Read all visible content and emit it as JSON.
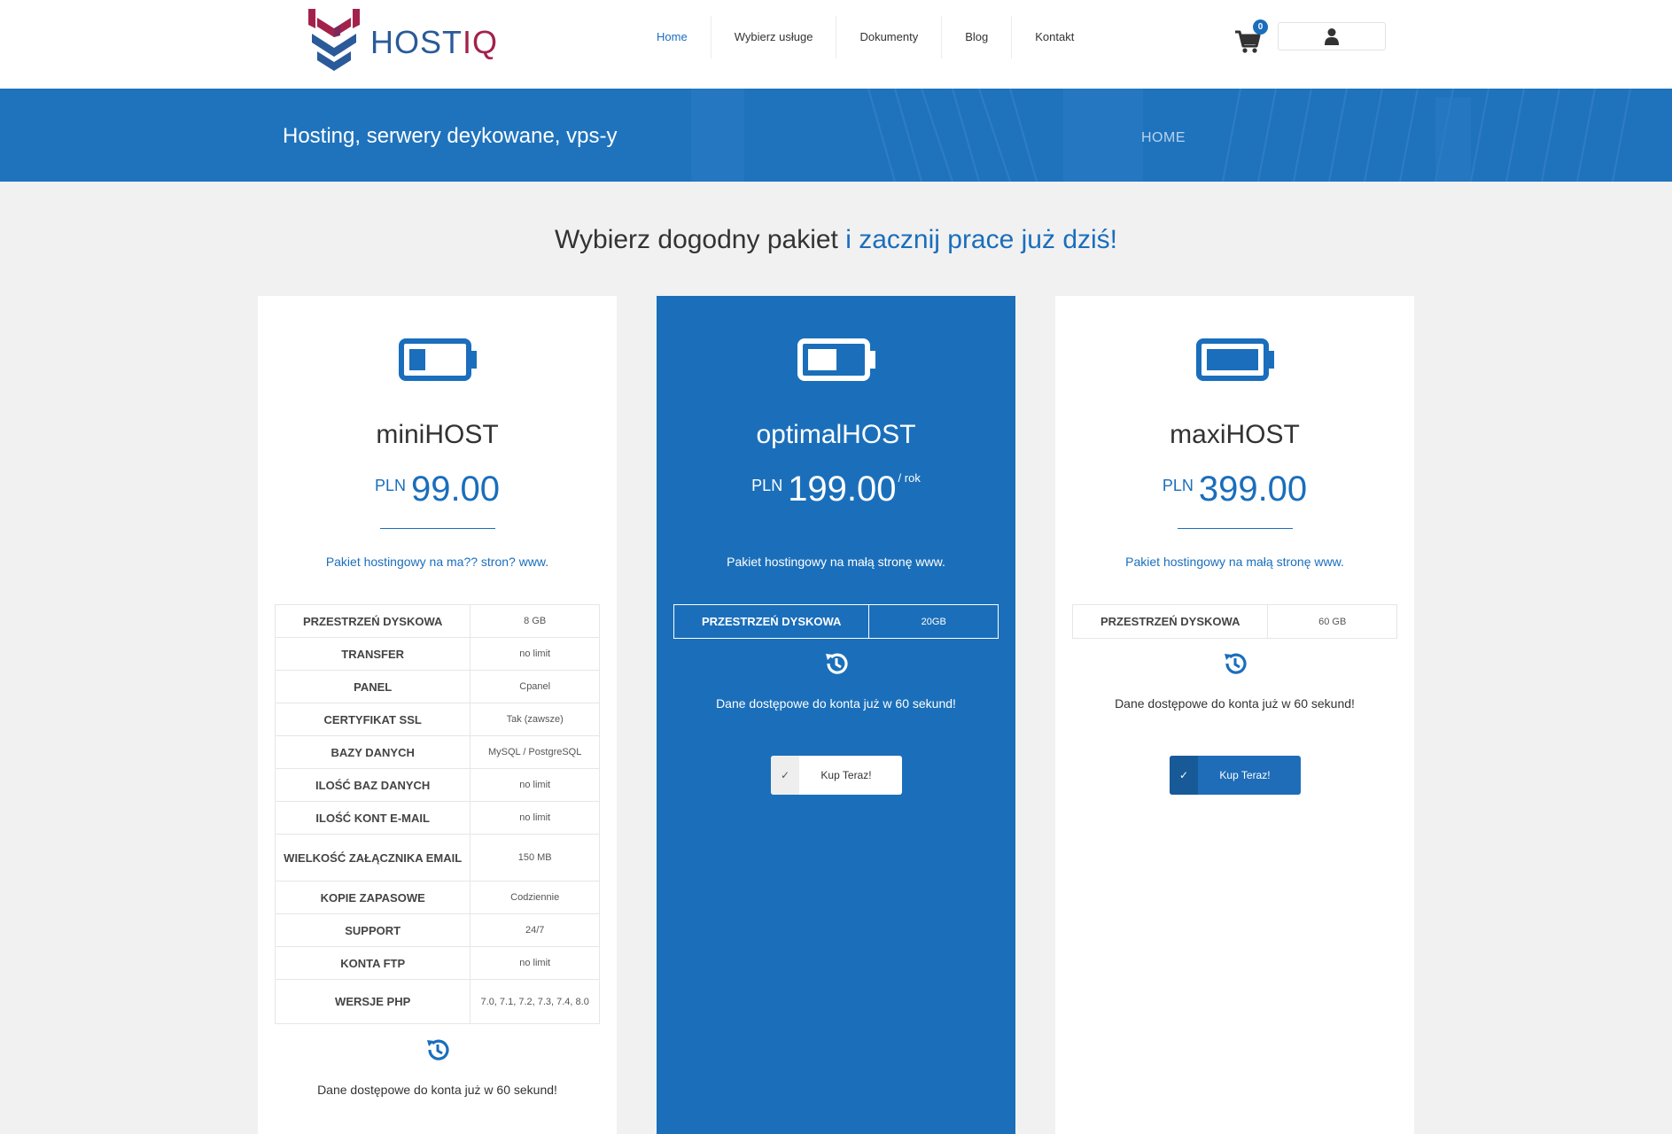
{
  "brand": {
    "name_part1": "HOST",
    "name_part2": "IQ"
  },
  "nav": {
    "items": [
      {
        "label": "Home",
        "active": true
      },
      {
        "label": "Wybierz usługe",
        "active": false
      },
      {
        "label": "Dokumenty",
        "active": false
      },
      {
        "label": "Blog",
        "active": false
      },
      {
        "label": "Kontakt",
        "active": false
      }
    ]
  },
  "cart": {
    "count": "0"
  },
  "banner": {
    "title": "Hosting, serwery deykowane, vps-y",
    "breadcrumb": "HOME"
  },
  "headline": {
    "main": "Wybierz dogodny pakiet ",
    "accent": "i zacznij prace już dziś!"
  },
  "plans": [
    {
      "name": "miniHOST",
      "currency": "PLN",
      "price": "99.00",
      "period": "",
      "description": "Pakiet hostingowy na ma?? stron? www.",
      "specs": [
        {
          "key": "Przestrzeń dyskowa",
          "value": "8 GB"
        },
        {
          "key": "Transfer",
          "value": "no limit"
        },
        {
          "key": "Panel",
          "value": "Cpanel"
        },
        {
          "key": "Certyfikat SSL",
          "value": "Tak (zawsze)"
        },
        {
          "key": "Bazy danych",
          "value": "MySQL / PostgreSQL"
        },
        {
          "key": "Ilość baz danych",
          "value": "no limit"
        },
        {
          "key": "Ilość kont e-mail",
          "value": "no limit"
        },
        {
          "key": "Wielkość załącznika email",
          "value": "150 MB"
        },
        {
          "key": "Kopie zapasowe",
          "value": "Codziennie"
        },
        {
          "key": "Support",
          "value": "24/7"
        },
        {
          "key": "Konta FTP",
          "value": "no limit"
        },
        {
          "key": "Wersje PHP",
          "value": "7.0, 7.1, 7.2, 7.3, 7.4, 8.0"
        }
      ],
      "activation": "Dane dostępowe do konta już w 60 sekund!",
      "button": ""
    },
    {
      "name": "optimalHOST",
      "currency": "PLN",
      "price": "199.00",
      "period": "/ rok",
      "description": "Pakiet hostingowy na małą stronę www.",
      "specs": [
        {
          "key": "Przestrzeń dyskowa",
          "value": "20GB"
        }
      ],
      "activation": "Dane dostępowe do konta już w 60 sekund!",
      "button": "Kup Teraz!"
    },
    {
      "name": "maxiHOST",
      "currency": "PLN",
      "price": "399.00",
      "period": "",
      "description": "Pakiet hostingowy na małą stronę www.",
      "specs": [
        {
          "key": "Przestrzeń dyskowa",
          "value": "60 GB"
        }
      ],
      "activation": "Dane dostępowe do konta już w 60 sekund!",
      "button": "Kup Teraz!"
    }
  ],
  "colors": {
    "brand_blue": "#1a6ebc",
    "brand_red": "#a3224b",
    "banner": "#1f73bd",
    "page_bg": "#f1f1f1"
  },
  "icons": {
    "cart": "cart-icon",
    "user": "user-icon",
    "battery": "battery-icon",
    "history": "history-icon",
    "check": "check-icon"
  }
}
